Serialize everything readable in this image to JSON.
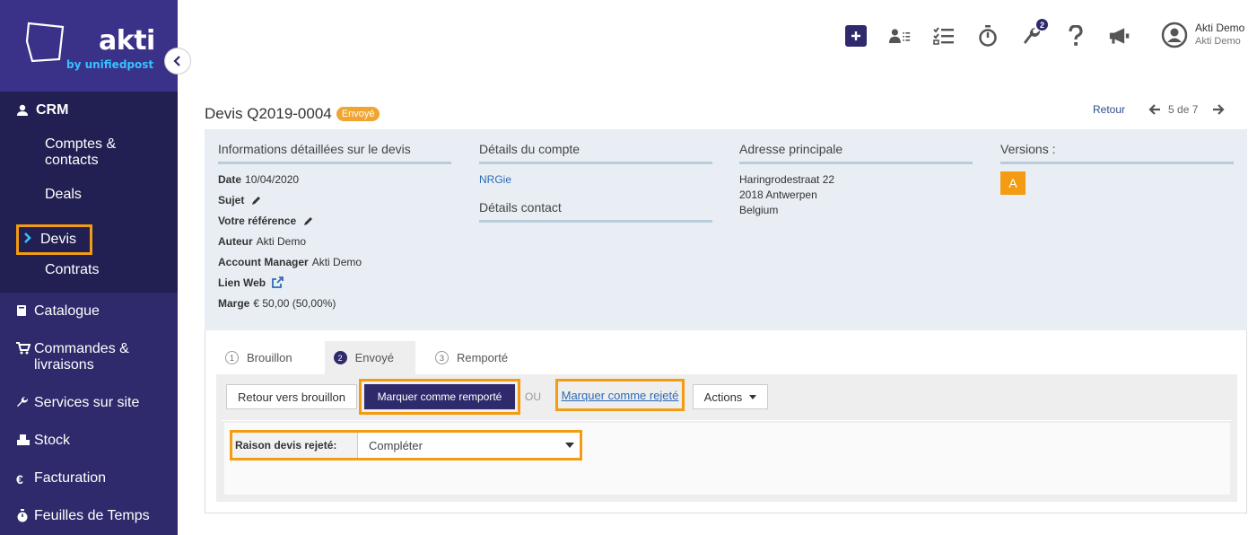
{
  "brand": {
    "name": "akti",
    "tagline": "by unifiedpost"
  },
  "sidebar": {
    "crm_label": "CRM",
    "crm_items": [
      {
        "label": "Comptes & contacts"
      },
      {
        "label": "Deals"
      },
      {
        "label": "Devis"
      },
      {
        "label": "Contrats"
      }
    ],
    "items": [
      {
        "label": "Catalogue",
        "icon": "book-icon"
      },
      {
        "label": "Commandes & livraisons",
        "icon": "cart-icon"
      },
      {
        "label": "Services sur site",
        "icon": "wrench-icon"
      },
      {
        "label": "Stock",
        "icon": "cubes-icon"
      },
      {
        "label": "Facturation",
        "icon": "euro-icon"
      },
      {
        "label": "Feuilles de Temps",
        "icon": "stopwatch-icon"
      }
    ]
  },
  "header": {
    "notification_count": "2",
    "user_name": "Akti Demo",
    "user_company": "Akti Demo"
  },
  "page": {
    "title": "Devis Q2019-0004",
    "status": "Envoyé",
    "pager": {
      "back": "Retour",
      "position": "5 de 7"
    }
  },
  "info": {
    "details": {
      "heading": "Informations détaillées sur le devis",
      "date_label": "Date",
      "date_value": "10/04/2020",
      "subject_label": "Sujet",
      "reference_label": "Votre référence",
      "author_label": "Auteur",
      "author_value": "Akti Demo",
      "manager_label": "Account Manager",
      "manager_value": "Akti Demo",
      "web_label": "Lien Web",
      "margin_label": "Marge",
      "margin_value": "€ 50,00 (50,00%)"
    },
    "account": {
      "heading": "Détails du compte",
      "name": "NRGie",
      "contact_heading": "Détails contact"
    },
    "address": {
      "heading": "Adresse principale",
      "line1": "Haringrodestraat 22",
      "line2": "2018 Antwerpen",
      "line3": "Belgium"
    },
    "versions": {
      "heading": "Versions :",
      "current": "A"
    }
  },
  "workflow": {
    "tabs": [
      {
        "num": "1",
        "label": "Brouillon"
      },
      {
        "num": "2",
        "label": "Envoyé"
      },
      {
        "num": "3",
        "label": "Remporté"
      }
    ],
    "back_to_draft": "Retour vers brouillon",
    "mark_won": "Marquer comme remporté",
    "or": "OU",
    "mark_rejected": "Marquer comme rejeté",
    "actions": "Actions",
    "reject_reason_label": "Raison devis rejeté:",
    "reject_reason_value": "Compléter"
  },
  "colors": {
    "sidebar": "#2e2a6b",
    "accent": "#f39c12",
    "link": "#2e6bb5"
  }
}
